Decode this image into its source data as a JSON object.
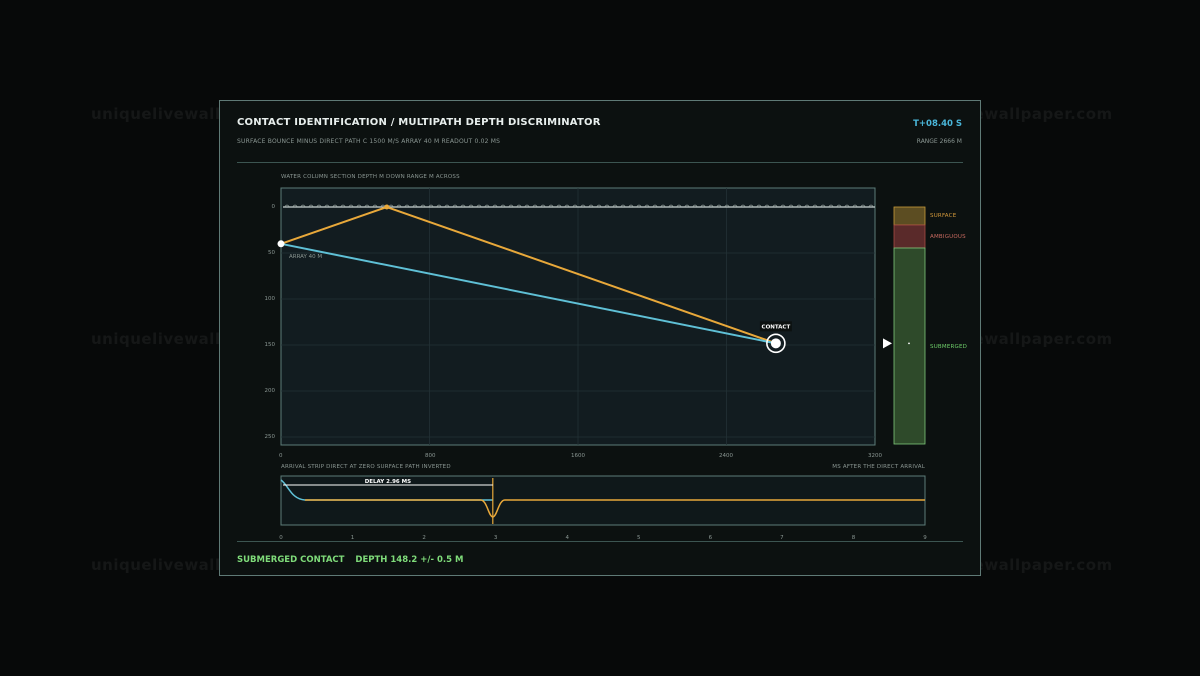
{
  "header": {
    "title": "CONTACT IDENTIFICATION / MULTIPATH DEPTH DISCRIMINATOR",
    "subtitle": "SURFACE BOUNCE MINUS DIRECT PATH   C 1500 M/S   ARRAY 40 M   READOUT 0.02 MS",
    "time": "T+08.40 S",
    "range": "RANGE 2666 M"
  },
  "section": {
    "caption": "WATER COLUMN SECTION   DEPTH M DOWN   RANGE M ACROSS",
    "array_label": "ARRAY 40 M",
    "contact_label": "CONTACT",
    "depth_ticks": [
      "0",
      "50",
      "100",
      "150",
      "200",
      "250"
    ],
    "range_ticks": [
      "0",
      "800",
      "1600",
      "2400",
      "3200"
    ]
  },
  "depth_bar": {
    "surface_label": "SURFACE",
    "ambiguous_label": "AMBIGUOUS",
    "submerged_label": "SUBMERGED",
    "colors": {
      "surface": "#5c4d22",
      "ambiguous": "#5a2a2a",
      "submerged": "#2e4a2a"
    }
  },
  "arrival": {
    "caption_left": "ARRIVAL STRIP   DIRECT AT ZERO   SURFACE PATH INVERTED",
    "caption_right": "MS AFTER THE DIRECT ARRIVAL",
    "delay_label": "DELAY 2.96 MS",
    "ms_ticks": [
      "0",
      "1",
      "2",
      "3",
      "4",
      "5",
      "6",
      "7",
      "8",
      "9"
    ]
  },
  "status": {
    "classification": "SUBMERGED CONTACT",
    "depth": "DEPTH 148.2 +/- 0.5 M"
  },
  "watermark_text": "uniquelivewallpaper.com",
  "chart_data": {
    "type": "line",
    "xlabel": "RANGE M ACROSS",
    "ylabel": "DEPTH M DOWN",
    "xlim": [
      0,
      3200
    ],
    "ylim": [
      0,
      255
    ],
    "array": {
      "range": 0,
      "depth": 40
    },
    "surface_bounce": {
      "range": 570,
      "depth": 0
    },
    "contact": {
      "range": 2666,
      "depth": 148.2
    },
    "delay_ms": 2.96,
    "arrival_xlim": [
      0,
      9
    ],
    "colors": {
      "direct": "#5fc0d6",
      "surface": "#e8a83a"
    }
  }
}
